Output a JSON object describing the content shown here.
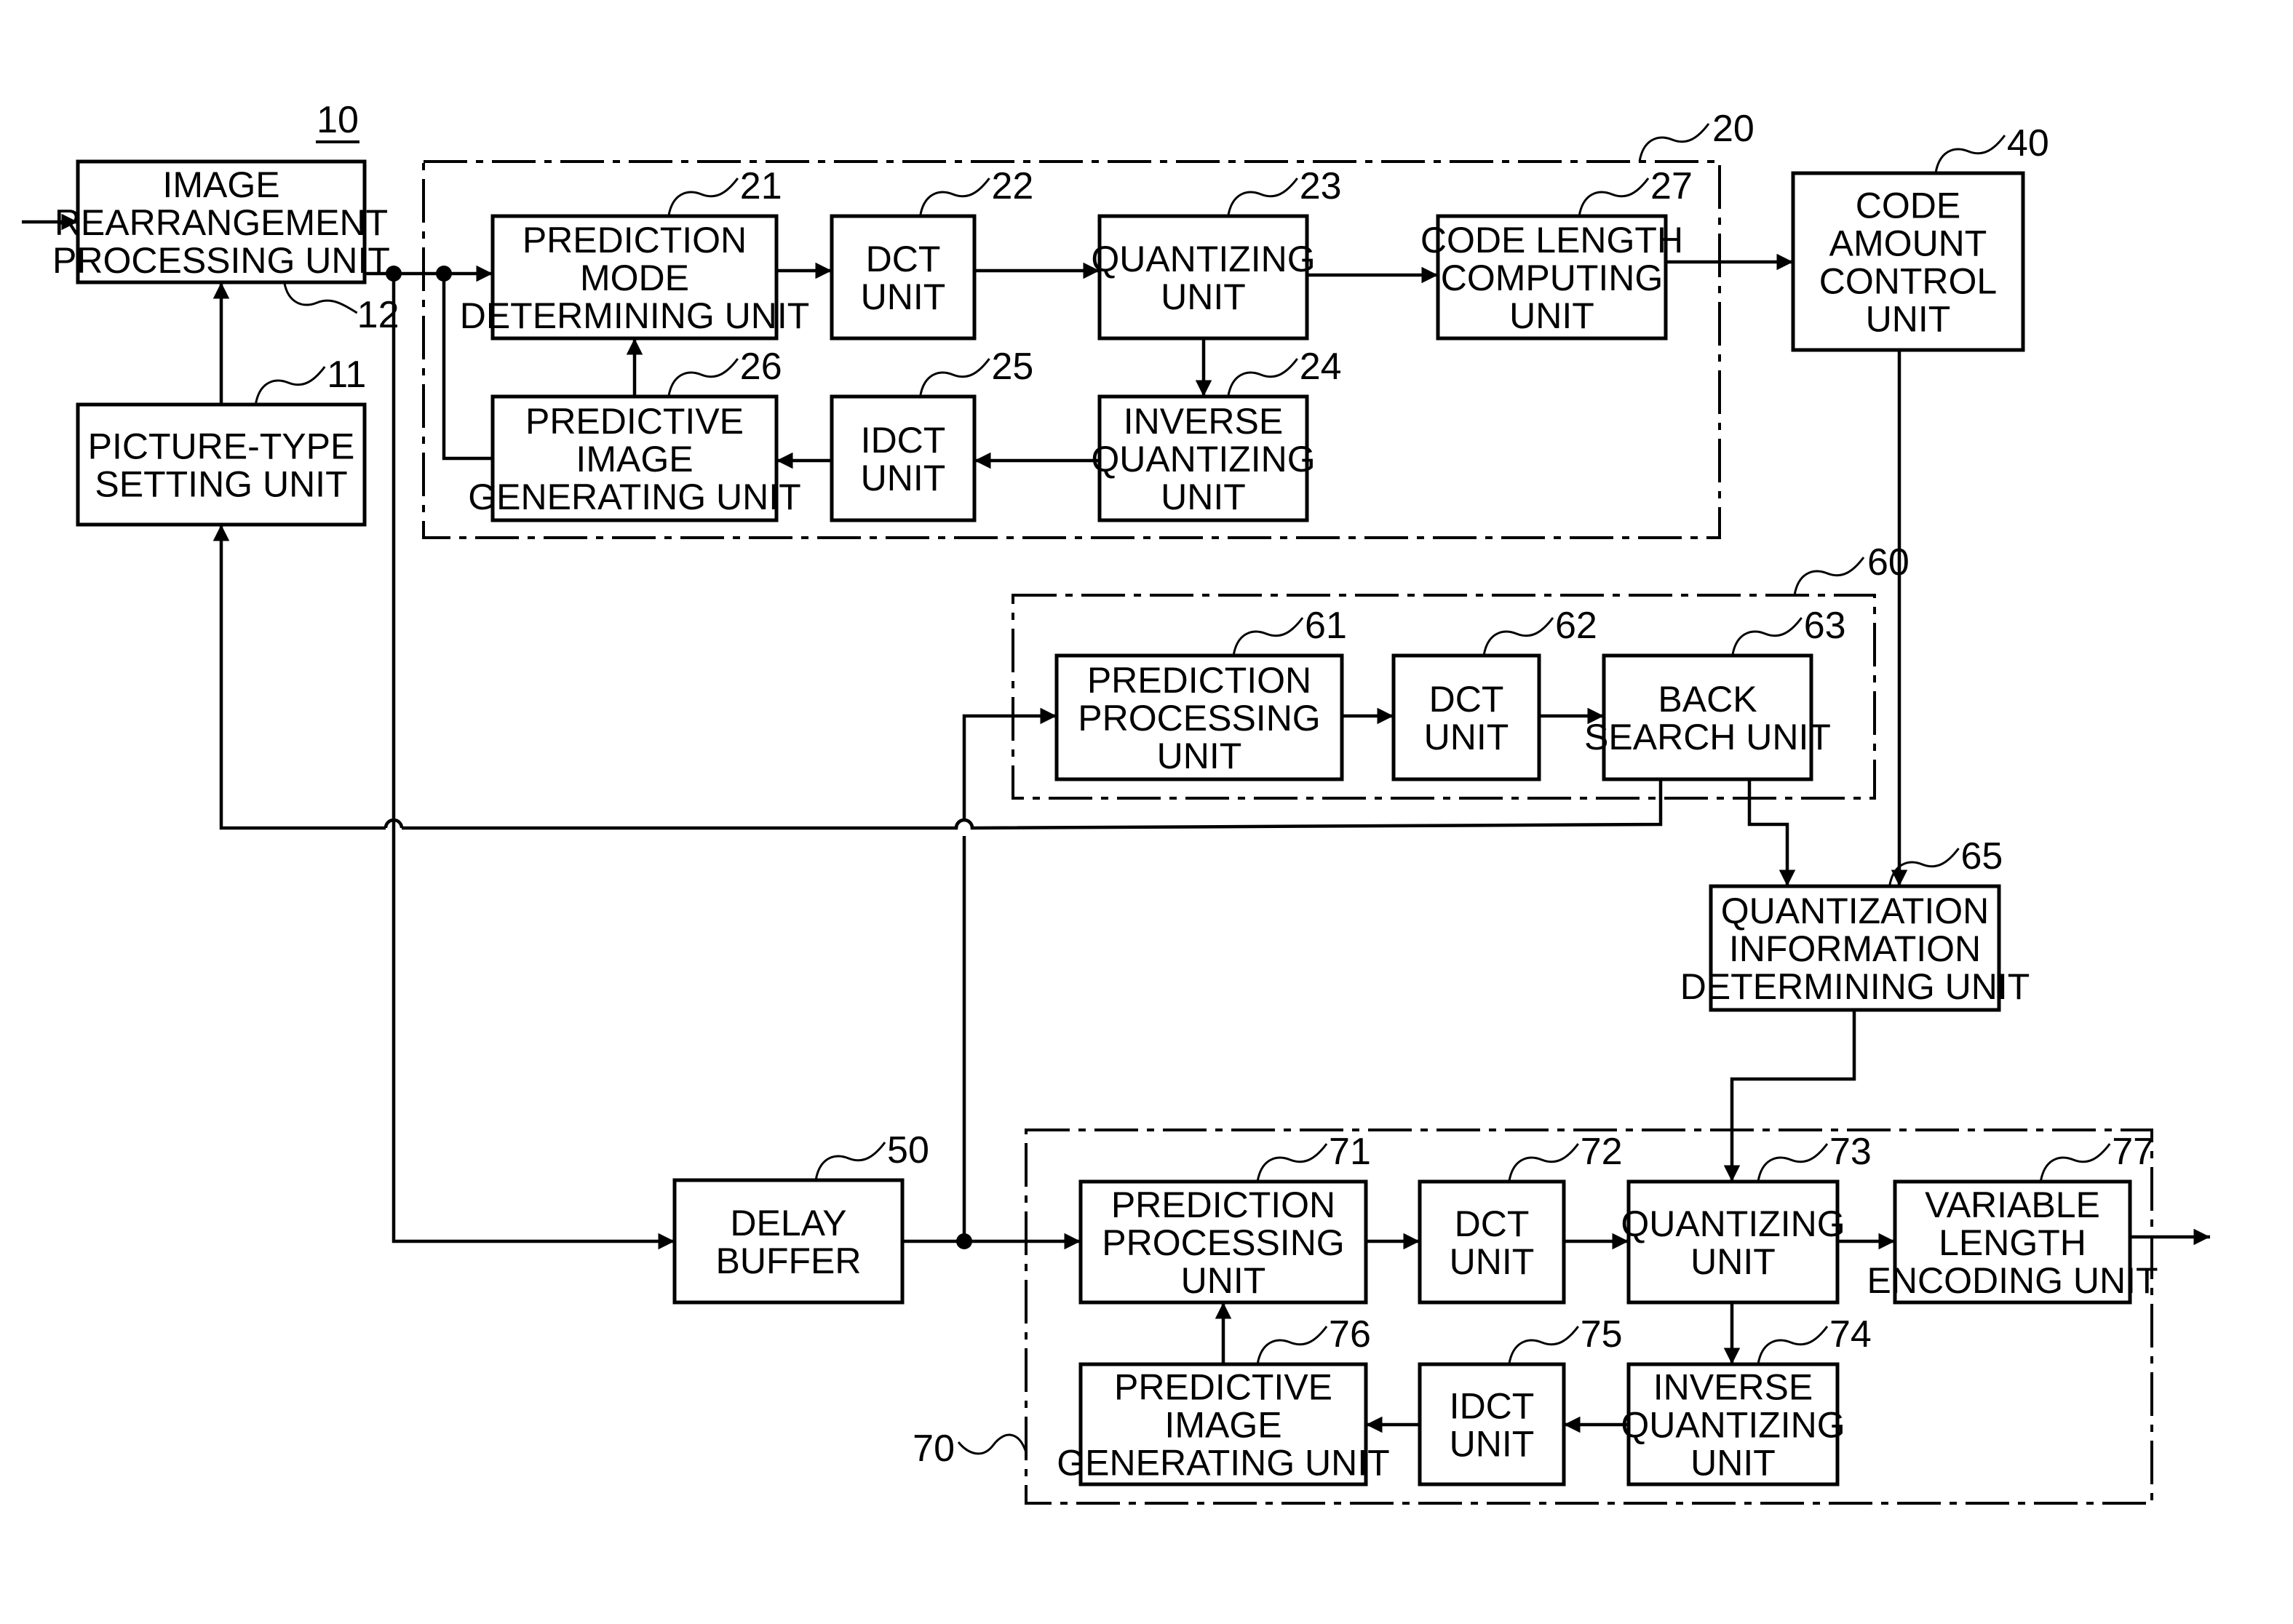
{
  "figure": {
    "device_ref": "10",
    "colors": {
      "ink": "#000000",
      "paper": "#ffffff"
    }
  },
  "groups": [
    {
      "id": "g20",
      "ref": "20"
    },
    {
      "id": "g60",
      "ref": "60"
    },
    {
      "id": "g70",
      "ref": "70"
    }
  ],
  "blocks": [
    {
      "id": "b12",
      "ref": "12",
      "lines": [
        "IMAGE",
        "REARRANGEMENT",
        "PROCESSING UNIT"
      ]
    },
    {
      "id": "b11",
      "ref": "11",
      "lines": [
        "PICTURE-TYPE",
        "SETTING UNIT"
      ]
    },
    {
      "id": "b21",
      "ref": "21",
      "lines": [
        "PREDICTION",
        "MODE",
        "DETERMINING UNIT"
      ]
    },
    {
      "id": "b22",
      "ref": "22",
      "lines": [
        "DCT",
        "UNIT"
      ]
    },
    {
      "id": "b23",
      "ref": "23",
      "lines": [
        "QUANTIZING",
        "UNIT"
      ]
    },
    {
      "id": "b27",
      "ref": "27",
      "lines": [
        "CODE LENGTH",
        "COMPUTING",
        "UNIT"
      ]
    },
    {
      "id": "b26",
      "ref": "26",
      "lines": [
        "PREDICTIVE",
        "IMAGE",
        "GENERATING UNIT"
      ]
    },
    {
      "id": "b25",
      "ref": "25",
      "lines": [
        "IDCT",
        "UNIT"
      ]
    },
    {
      "id": "b24",
      "ref": "24",
      "lines": [
        "INVERSE",
        "QUANTIZING",
        "UNIT"
      ]
    },
    {
      "id": "b40",
      "ref": "40",
      "lines": [
        "CODE",
        "AMOUNT",
        "CONTROL",
        "UNIT"
      ]
    },
    {
      "id": "b61",
      "ref": "61",
      "lines": [
        "PREDICTION",
        "PROCESSING",
        "UNIT"
      ]
    },
    {
      "id": "b62",
      "ref": "62",
      "lines": [
        "DCT",
        "UNIT"
      ]
    },
    {
      "id": "b63",
      "ref": "63",
      "lines": [
        "BACK",
        "SEARCH UNIT"
      ]
    },
    {
      "id": "b65",
      "ref": "65",
      "lines": [
        "QUANTIZATION",
        "INFORMATION",
        "DETERMINING UNIT"
      ]
    },
    {
      "id": "b50",
      "ref": "50",
      "lines": [
        "DELAY",
        "BUFFER"
      ]
    },
    {
      "id": "b71",
      "ref": "71",
      "lines": [
        "PREDICTION",
        "PROCESSING",
        "UNIT"
      ]
    },
    {
      "id": "b72",
      "ref": "72",
      "lines": [
        "DCT",
        "UNIT"
      ]
    },
    {
      "id": "b73",
      "ref": "73",
      "lines": [
        "QUANTIZING",
        "UNIT"
      ]
    },
    {
      "id": "b77",
      "ref": "77",
      "lines": [
        "VARIABLE",
        "LENGTH",
        "ENCODING UNIT"
      ]
    },
    {
      "id": "b76",
      "ref": "76",
      "lines": [
        "PREDICTIVE",
        "IMAGE",
        "GENERATING UNIT"
      ]
    },
    {
      "id": "b75",
      "ref": "75",
      "lines": [
        "IDCT",
        "UNIT"
      ]
    },
    {
      "id": "b74",
      "ref": "74",
      "lines": [
        "INVERSE",
        "QUANTIZING",
        "UNIT"
      ]
    }
  ]
}
